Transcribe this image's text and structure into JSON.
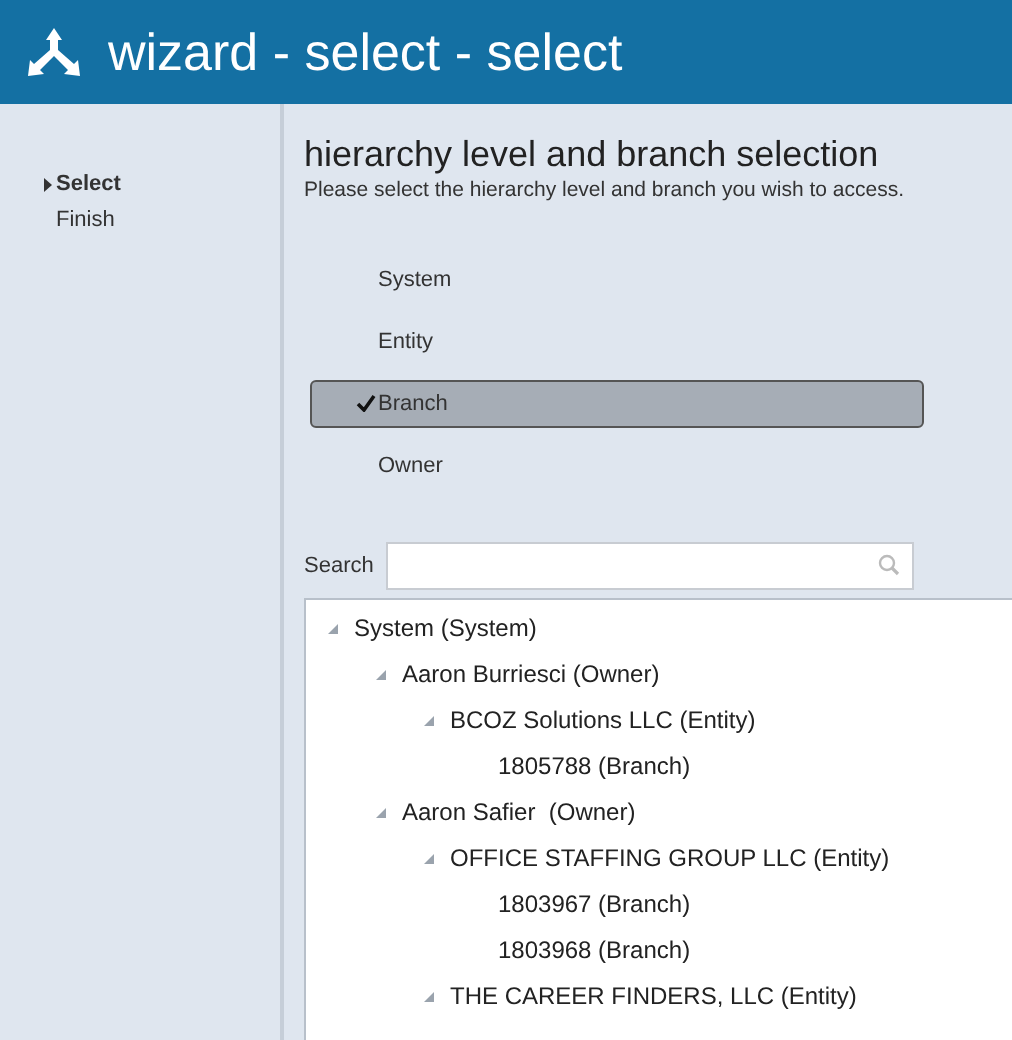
{
  "window": {
    "title": "wizard - select - select"
  },
  "steps": [
    {
      "label": "Select",
      "selected": true
    },
    {
      "label": "Finish",
      "selected": false
    }
  ],
  "heading": "hierarchy level and branch selection",
  "description": "Please select the hierarchy level and branch you wish to access.",
  "levels": [
    {
      "label": "System",
      "selected": false
    },
    {
      "label": "Entity",
      "selected": false
    },
    {
      "label": "Branch",
      "selected": true
    },
    {
      "label": "Owner",
      "selected": false
    }
  ],
  "search": {
    "label": "Search"
  },
  "tree": [
    {
      "label": "System (System)",
      "expanded": true,
      "children": [
        {
          "label": "Aaron Burriesci (Owner)",
          "expanded": true,
          "children": [
            {
              "label": "BCOZ Solutions LLC (Entity)",
              "expanded": true,
              "children": [
                {
                  "label": "1805788 (Branch)"
                }
              ]
            }
          ]
        },
        {
          "label": "Aaron Safier  (Owner)",
          "expanded": true,
          "children": [
            {
              "label": "OFFICE STAFFING GROUP LLC (Entity)",
              "expanded": true,
              "children": [
                {
                  "label": "1803967 (Branch)"
                },
                {
                  "label": "1803968 (Branch)"
                }
              ]
            },
            {
              "label": "THE CAREER FINDERS, LLC (Entity)",
              "expanded": true
            }
          ]
        }
      ]
    }
  ]
}
